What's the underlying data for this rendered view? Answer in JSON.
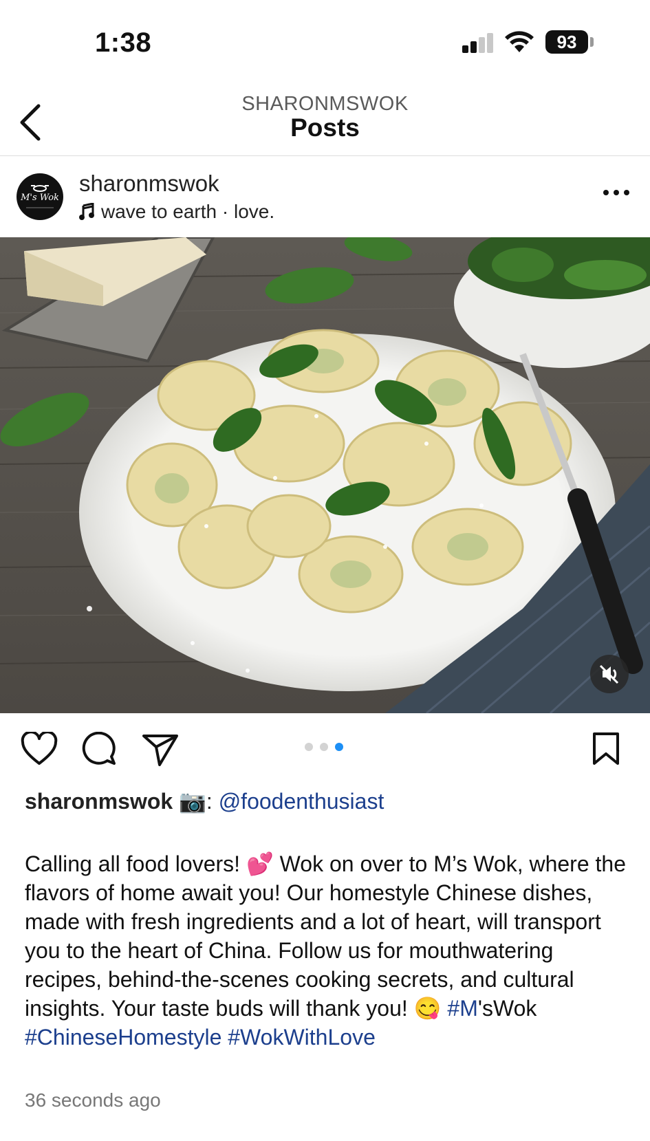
{
  "status_bar": {
    "time": "1:38",
    "battery": "93"
  },
  "nav": {
    "subtitle": "SHARONMSWOK",
    "title": "Posts"
  },
  "post": {
    "username": "sharonmswok",
    "audio": "wave to earth · love.",
    "avatar_text": "M's Wok",
    "carousel": {
      "count": 3,
      "active_index": 2
    },
    "caption": {
      "username": "sharonmswok",
      "camera_emoji": "📷",
      "credit_sep": ":",
      "credit_handle": "@foodenthusiast",
      "text_1": "Calling all food lovers! ",
      "emoji_1": "💕",
      "text_2": " Wok on over to M’s Wok, where the flavors of home await you! Our homestyle Chinese dishes, made with fresh ingredients and a lot of heart, will transport you to the heart of China. Follow us for mouthwatering recipes, behind-the-scenes cooking secrets, and cultural insights. Your taste buds will thank you! ",
      "emoji_2": "😋",
      "hashtag_1": "#M",
      "text_3": "'sWok ",
      "hashtag_2": "#ChineseHomestyle",
      "hashtag_3": "#WokWithLove"
    },
    "timestamp": "36 seconds ago"
  }
}
